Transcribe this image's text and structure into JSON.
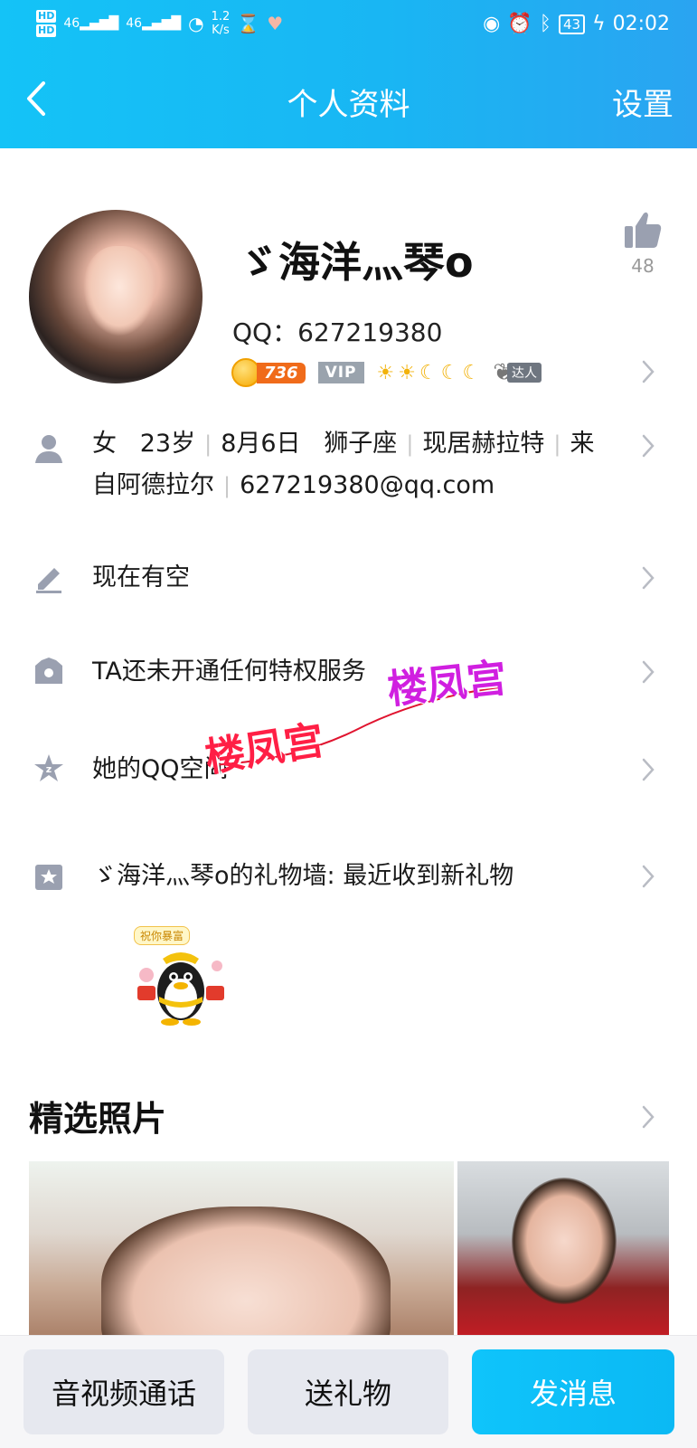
{
  "status_bar": {
    "hd_top": "HD",
    "hd_bottom": "HD",
    "signal1": "46",
    "signal2": "46",
    "speed_value": "1.2",
    "speed_unit": "K/s",
    "battery": "43",
    "time": "02:02",
    "icons": [
      "hourglass-icon",
      "heart-health-icon",
      "eye-icon",
      "alarm-icon",
      "bluetooth-icon",
      "charging-icon"
    ]
  },
  "nav": {
    "title": "个人资料",
    "settings_label": "设置",
    "back_icon": "chevron-left-icon"
  },
  "profile": {
    "nickname": "ゞ海洋灬琴o",
    "qq_line": "QQ：627219380",
    "coin_level": "736",
    "vip_label": "VIP",
    "level_icons": [
      "☀",
      "☀",
      "☾",
      "☾",
      "☾"
    ],
    "daren_label": "达人",
    "like_count": "48"
  },
  "info": {
    "items": [
      "女",
      "23岁",
      "8月6日",
      "狮子座",
      "现居赫拉特",
      "来"
    ],
    "line2_a": "自阿德拉尔",
    "line2_b": "627219380@qq.com"
  },
  "rows": {
    "status": "现在有空",
    "privilege": "TA还未开通任何特权服务",
    "qzone": "她的QQ空间",
    "gift_wall": "ゞ海洋灬琴o的礼物墙: 最近收到新礼物",
    "gift_banner": "祝你暴富"
  },
  "watermark": {
    "text1": "楼凤宫",
    "text2": "楼凤宫"
  },
  "photos": {
    "section_title": "精选照片"
  },
  "actions": {
    "call": "音视频通话",
    "gift": "送礼物",
    "message": "发消息"
  },
  "colors": {
    "header": "#19b6f3",
    "primary_button": "#0fc4fb",
    "icon_gray": "#9aa0b0"
  }
}
